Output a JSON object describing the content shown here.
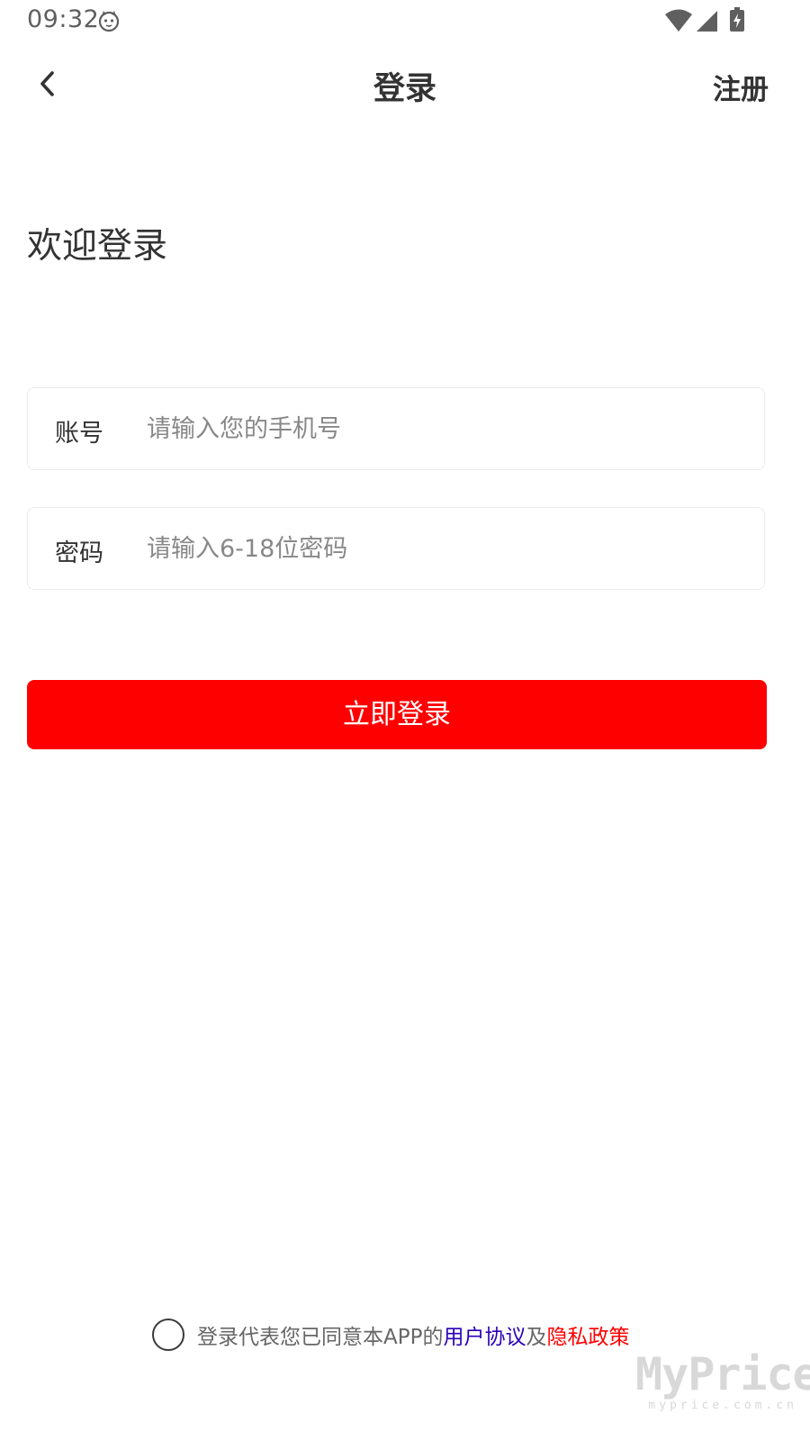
{
  "status_bar": {
    "time": "09:32",
    "icons": [
      "cat-icon",
      "wifi-icon",
      "signal-icon",
      "battery-charging-icon"
    ]
  },
  "header": {
    "back_icon": "chevron-left-icon",
    "title": "登录",
    "register_label": "注册"
  },
  "welcome": {
    "text": "欢迎登录"
  },
  "form": {
    "account": {
      "label": "账号",
      "placeholder": "请输入您的手机号",
      "value": ""
    },
    "password": {
      "label": "密码",
      "placeholder": "请输入6-18位密码",
      "value": ""
    },
    "login_button": "立即登录"
  },
  "agreement": {
    "checked": false,
    "prefix": "登录代表您已同意本APP的",
    "user_agreement": "用户协议",
    "and": "及",
    "privacy_policy": "隐私政策"
  },
  "watermark": {
    "main": "MyPrice",
    "sub": "myprice.com.cn"
  },
  "colors": {
    "accent": "#ff0000",
    "user_agreement_link": "#2b00b8",
    "privacy_link": "#ff0000",
    "text_primary": "#333333",
    "text_secondary": "#666666"
  }
}
